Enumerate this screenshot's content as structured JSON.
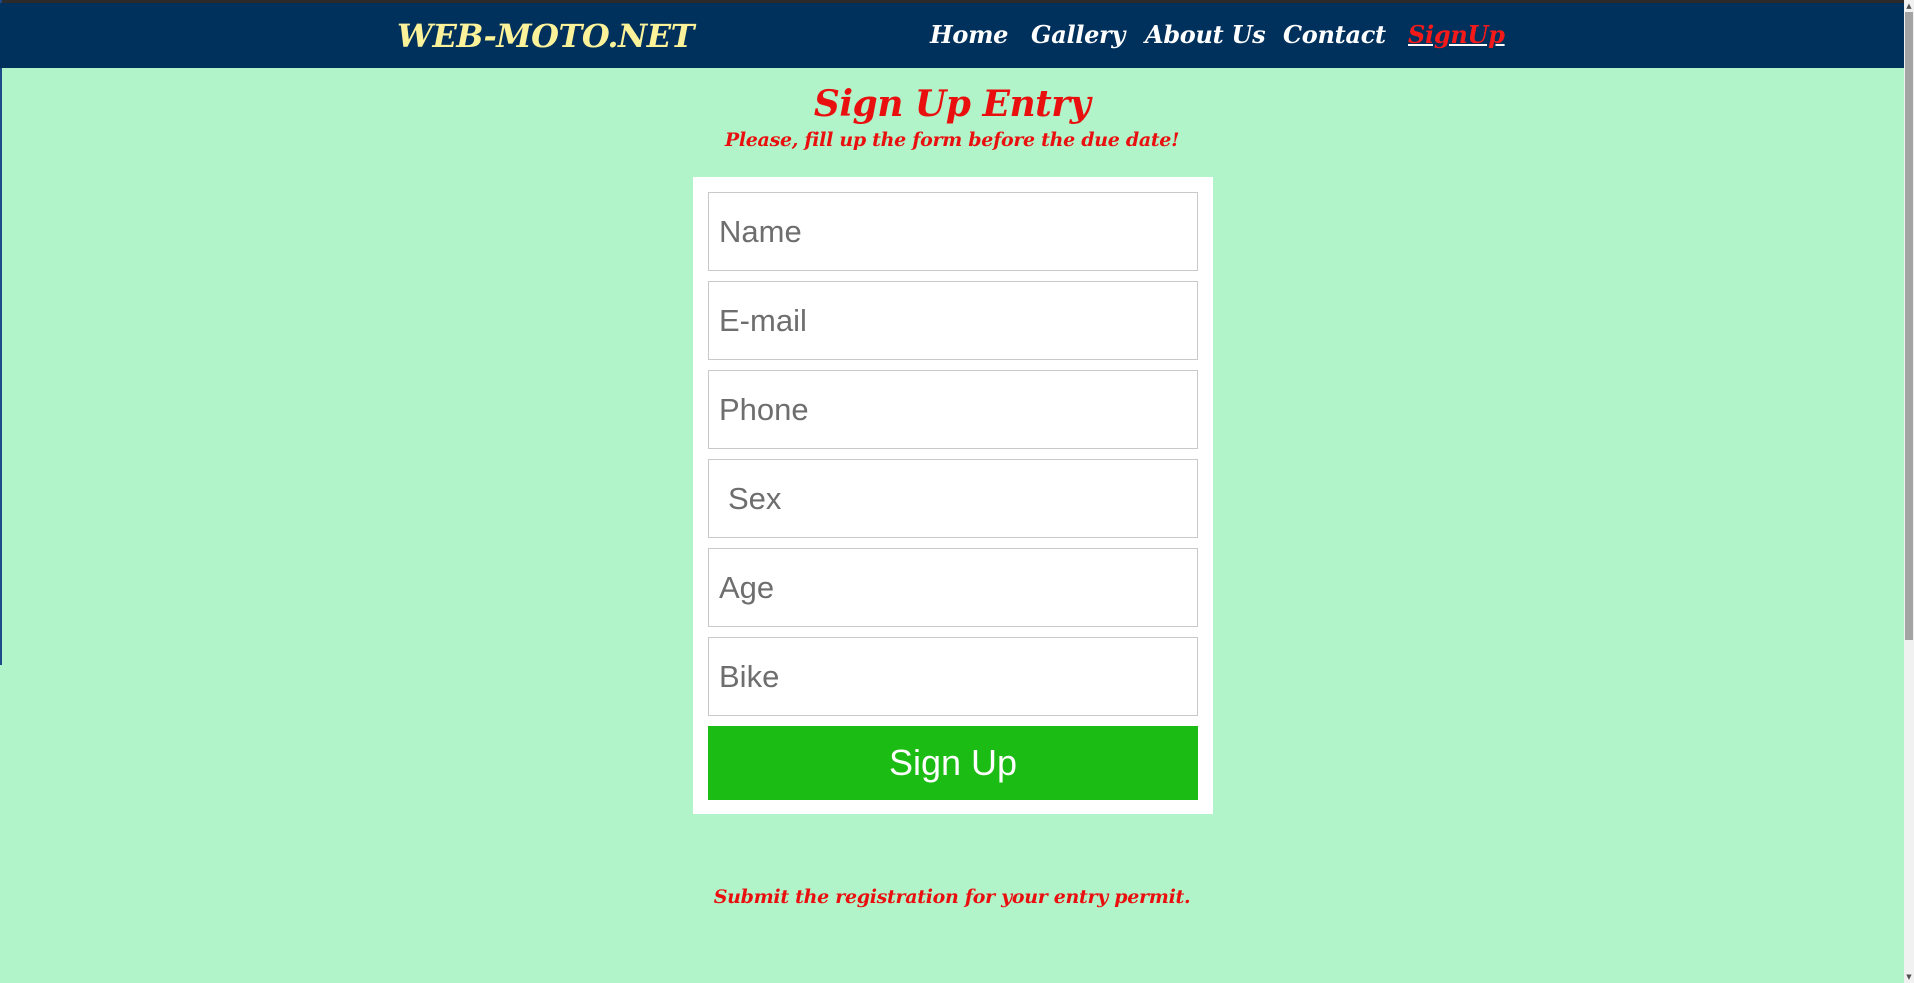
{
  "header": {
    "brand": "WEB-MOTO.NET",
    "nav": {
      "home": "Home",
      "gallery": "Gallery",
      "about": "About Us",
      "contact": "Contact",
      "signup": "SignUp"
    }
  },
  "page": {
    "title": "Sign Up Entry",
    "subtitle": "Please, fill up the form before the due date!",
    "footer_note": "Submit the registration for your entry permit."
  },
  "form": {
    "name_placeholder": "Name",
    "email_placeholder": "E-mail",
    "phone_placeholder": "Phone",
    "sex_placeholder": "Sex",
    "age_placeholder": "Age",
    "bike_placeholder": "Bike",
    "submit_label": "Sign Up"
  },
  "colors": {
    "navbar": "#00305c",
    "brand": "#fbf29a",
    "accent_red": "#ea0f0f",
    "background": "#b2f4ca",
    "button": "#1bbd14"
  }
}
